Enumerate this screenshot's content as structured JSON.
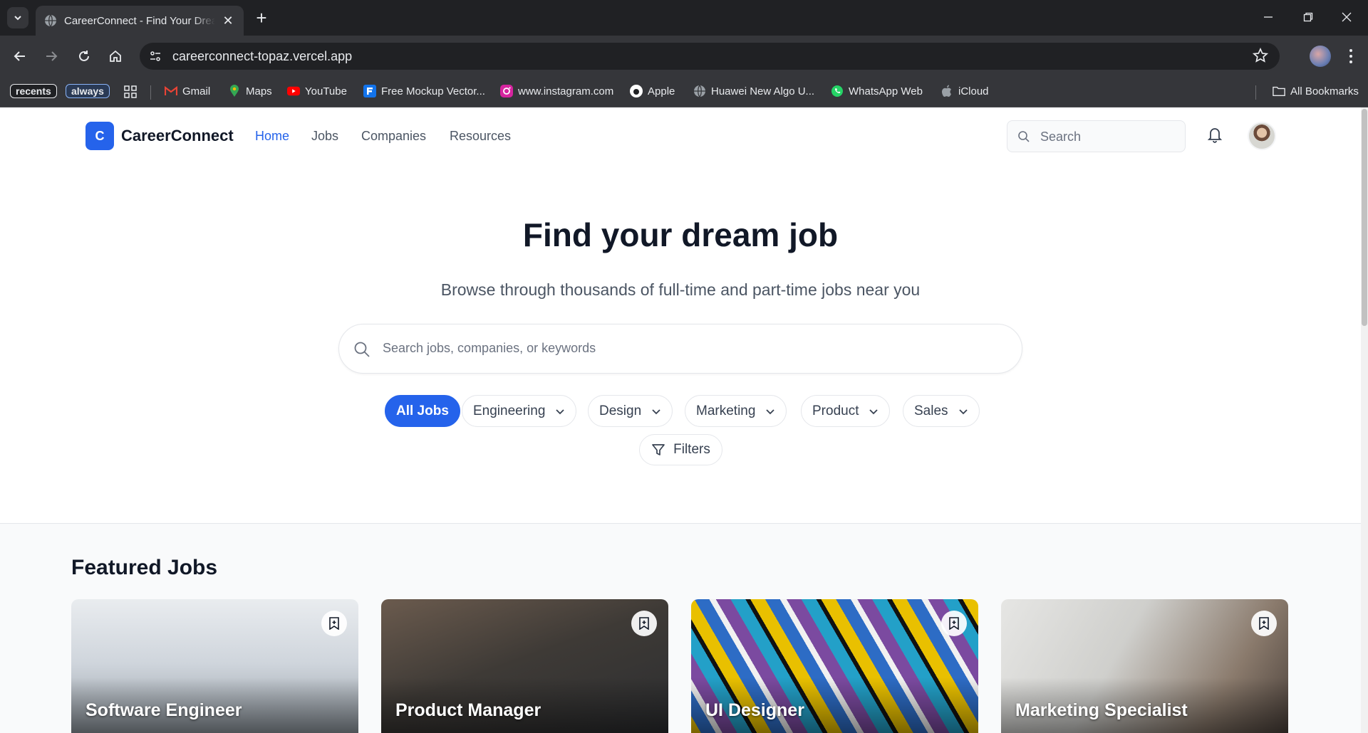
{
  "browser": {
    "tab_title": "CareerConnect - Find Your Dream Job",
    "url": "careerconnect-topaz.vercel.app",
    "bookmarks": {
      "chip_1": "recents",
      "chip_2": "always",
      "gmail": "Gmail",
      "maps": "Maps",
      "youtube": "YouTube",
      "mockup": "Free Mockup Vector...",
      "instagram": "www.instagram.com",
      "apple": "Apple",
      "huawei": "Huawei New Algo U...",
      "whatsapp": "WhatsApp Web",
      "icloud": "iCloud",
      "all": "All Bookmarks"
    }
  },
  "header": {
    "logo_letter": "C",
    "brand": "CareerConnect",
    "nav": {
      "home": "Home",
      "jobs": "Jobs",
      "companies": "Companies",
      "resources": "Resources"
    },
    "search_placeholder": "Search"
  },
  "hero": {
    "title": "Find your dream job",
    "subtitle": "Browse through thousands of full-time and part-time jobs near you",
    "search_placeholder": "Search jobs, companies, or keywords",
    "categories": {
      "all": "All Jobs",
      "engineering": "Engineering",
      "design": "Design",
      "marketing": "Marketing",
      "product": "Product",
      "sales": "Sales"
    },
    "filters_label": "Filters"
  },
  "featured": {
    "title": "Featured Jobs",
    "jobs": [
      {
        "title": "Software Engineer"
      },
      {
        "title": "Product Manager"
      },
      {
        "title": "UI Designer"
      },
      {
        "title": "Marketing Specialist"
      }
    ]
  },
  "colors": {
    "accent": "#2563eb",
    "heading": "#111827",
    "muted": "#4b5563",
    "chrome_dark": "#202124",
    "chrome_mid": "#35363a"
  }
}
